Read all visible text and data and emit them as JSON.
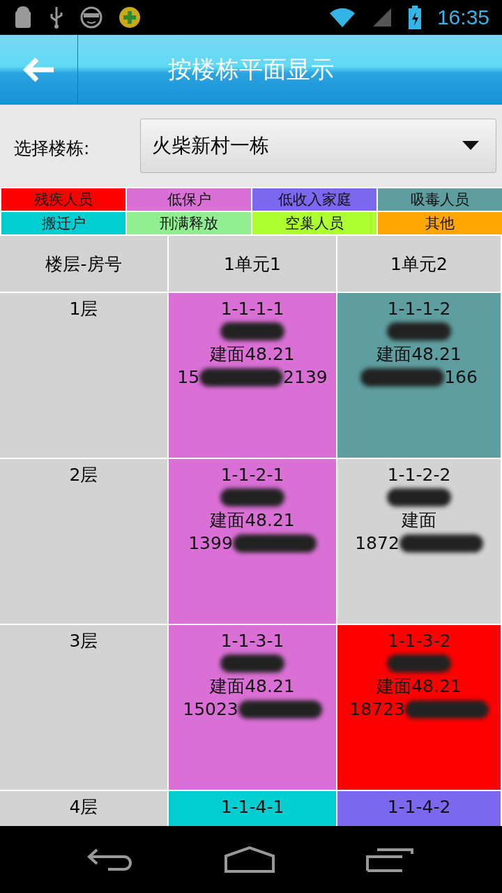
{
  "status_bar": {
    "time": "16:35"
  },
  "header": {
    "title": "按楼栋平面显示"
  },
  "selector": {
    "label": "选择楼栋:",
    "value": "火柴新村一栋"
  },
  "legend": [
    {
      "label": "残疾人员",
      "color": "#ff0000"
    },
    {
      "label": "低保户",
      "color": "#da70d6"
    },
    {
      "label": "低收入家庭",
      "color": "#7b68ee"
    },
    {
      "label": "吸毒人员",
      "color": "#5f9ea0"
    },
    {
      "label": "搬迁户",
      "color": "#00ced1"
    },
    {
      "label": "刑满释放",
      "color": "#90ee90"
    },
    {
      "label": "空巢人员",
      "color": "#adff2f"
    },
    {
      "label": "其他",
      "color": "#ffa500"
    }
  ],
  "table": {
    "columns": [
      "楼层-房号",
      "1单元1",
      "1单元2"
    ],
    "rows": [
      {
        "cells": [
          {
            "kind": "floor",
            "text": "1层"
          },
          {
            "kind": "room",
            "room": "1-1-1-1",
            "color": "#da70d6",
            "name_redacted": true,
            "area": "建面48.21",
            "phone_redacted": true,
            "phone_start": "15",
            "phone_end": "2139"
          },
          {
            "kind": "room",
            "room": "1-1-1-2",
            "color": "#5f9ea0",
            "name_redacted": true,
            "area": "建面48.21",
            "phone_redacted": true,
            "phone_end": "166"
          }
        ]
      },
      {
        "cells": [
          {
            "kind": "floor",
            "text": "2层"
          },
          {
            "kind": "room",
            "room": "1-1-2-1",
            "color": "#da70d6",
            "name_redacted": true,
            "area": "建面48.21",
            "phone_redacted": true,
            "phone_start": "1399"
          },
          {
            "kind": "room",
            "room": "1-1-2-2",
            "color": "#d3d3d3",
            "name_redacted": true,
            "area": "建面",
            "phone_redacted": true,
            "phone_start": "1872"
          }
        ]
      },
      {
        "cells": [
          {
            "kind": "floor",
            "text": "3层"
          },
          {
            "kind": "room",
            "room": "1-1-3-1",
            "color": "#da70d6",
            "name_redacted": true,
            "area": "建面48.21",
            "phone_redacted": true,
            "phone_start": "15023"
          },
          {
            "kind": "room",
            "room": "1-1-3-2",
            "color": "#ff0000",
            "name_redacted": true,
            "area": "建面48.21",
            "phone_redacted": true,
            "phone_start": "18723"
          }
        ]
      },
      {
        "cells": [
          {
            "kind": "floor",
            "text": "4层"
          },
          {
            "kind": "room",
            "room": "1-1-4-1",
            "color": "#00ced1"
          },
          {
            "kind": "room",
            "room": "1-1-4-2",
            "color": "#7b68ee"
          }
        ]
      }
    ]
  }
}
